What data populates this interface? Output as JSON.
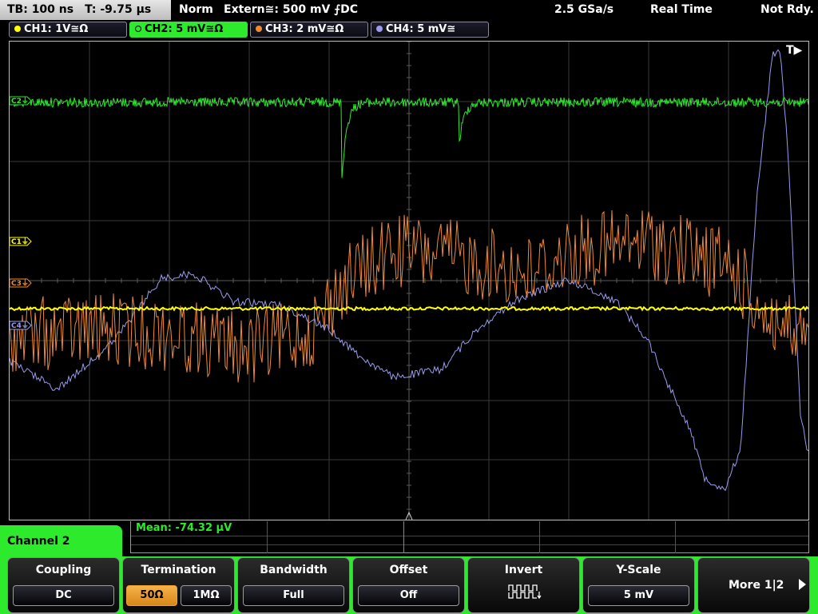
{
  "status": {
    "timebase": "TB: 100 ns",
    "trigger_time": "T: -9.75 µs",
    "trigger_mode": "Norm",
    "trigger_source": "Extern≅: 500 mV ⨍DC",
    "sample_rate": "2.5 GSa/s",
    "acquire_mode": "Real Time",
    "ready_state": "Not Rdy."
  },
  "channels": [
    {
      "label": "CH1: 1V≅Ω",
      "color": "#ffff00"
    },
    {
      "label": "CH2: 5 mV≅Ω",
      "color": "#2dea2d"
    },
    {
      "label": "CH3: 2 mV≅Ω",
      "color": "#f08a30"
    },
    {
      "label": "CH4: 5 mV≅",
      "color": "#9a9aee"
    }
  ],
  "markers": {
    "ch1": "C1⏚",
    "ch2": "C2⏚",
    "ch3": "C3⏚",
    "ch4": "C4⏚",
    "trigger": "T▶"
  },
  "measurement": {
    "mean": "Mean: -74.32 µV"
  },
  "menu": {
    "title": "Channel 2",
    "softkeys": {
      "coupling": {
        "title": "Coupling",
        "value": "DC"
      },
      "termination": {
        "title": "Termination",
        "options": [
          "50Ω",
          "1MΩ"
        ],
        "selected": "50Ω"
      },
      "bandwidth": {
        "title": "Bandwidth",
        "value": "Full"
      },
      "offset": {
        "title": "Offset",
        "value": "Off"
      },
      "invert": {
        "title": "Invert",
        "icon": "invert-waveform-icon"
      },
      "yscale": {
        "title": "Y-Scale",
        "value": "5 mV"
      },
      "more": {
        "label": "More 1|2",
        "icon": "right-arrow-icon"
      }
    }
  }
}
